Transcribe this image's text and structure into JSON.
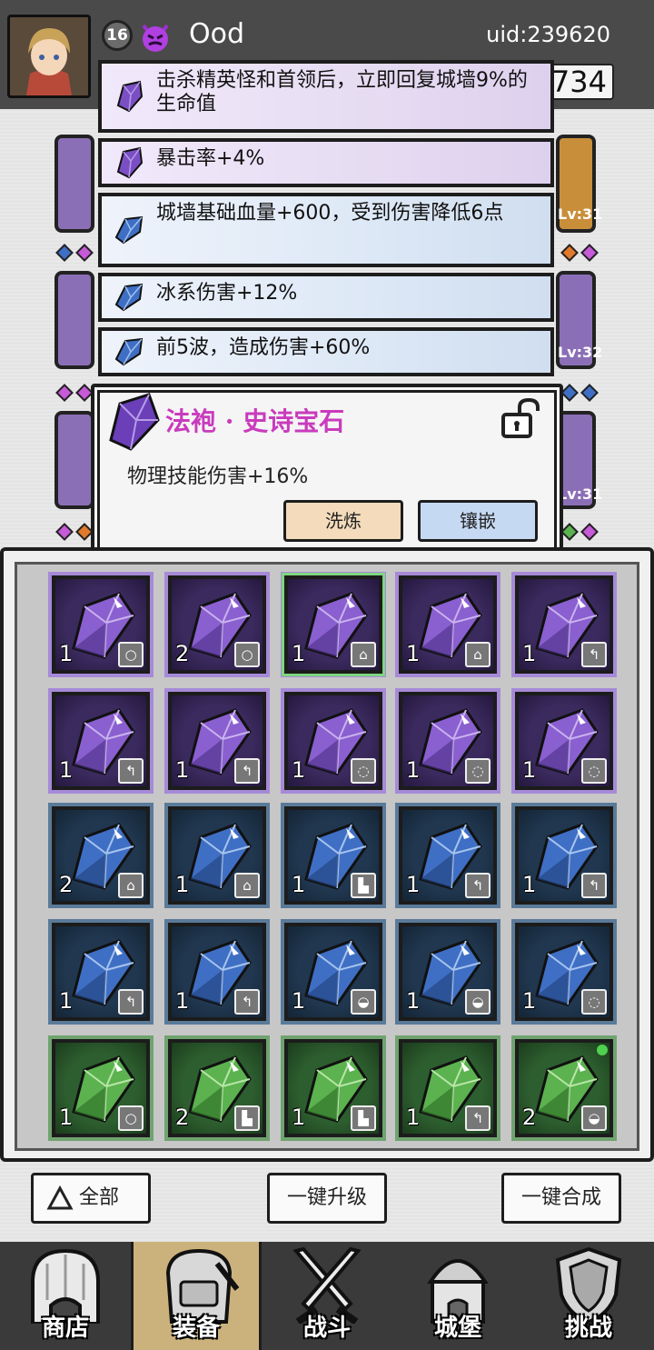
{
  "player": {
    "level": "16",
    "name": "Ood",
    "uid": "uid:239620",
    "gold": "734",
    "status_icon": "devil-icon"
  },
  "equipment_slots": {
    "right_levels": [
      "Lv:31",
      "Lv:32",
      "Lv:31"
    ]
  },
  "stats": [
    {
      "text": "击杀精英怪和首领后，立即回复城墙9%的生命值",
      "gem": "purple"
    },
    {
      "text": "暴击率+4%",
      "gem": "purple"
    },
    {
      "text": "城墙基础血量+600，受到伤害降低6点",
      "gem": "blue"
    },
    {
      "text": "冰系伤害+12%",
      "gem": "blue"
    },
    {
      "text": "前5波，造成伤害+60%",
      "gem": "blue"
    }
  ],
  "popup": {
    "title": "法袍 · 史诗宝石",
    "description": "物理技能伤害+16%",
    "refine_label": "洗炼",
    "inlay_label": "镶嵌",
    "lock_icon": "unlock-icon"
  },
  "inventory": {
    "rows": [
      [
        {
          "rarity": "epic",
          "count": "1",
          "type": "ring"
        },
        {
          "rarity": "epic",
          "count": "2",
          "type": "ring"
        },
        {
          "rarity": "epic",
          "count": "1",
          "type": "robe"
        },
        {
          "rarity": "epic",
          "count": "1",
          "type": "robe"
        },
        {
          "rarity": "epic",
          "count": "1",
          "type": "staff"
        }
      ],
      [
        {
          "rarity": "epic",
          "count": "1",
          "type": "staff"
        },
        {
          "rarity": "epic",
          "count": "1",
          "type": "staff"
        },
        {
          "rarity": "epic",
          "count": "1",
          "type": "necklace"
        },
        {
          "rarity": "epic",
          "count": "1",
          "type": "necklace"
        },
        {
          "rarity": "epic",
          "count": "1",
          "type": "necklace"
        }
      ],
      [
        {
          "rarity": "rare",
          "count": "2",
          "type": "robe"
        },
        {
          "rarity": "rare",
          "count": "1",
          "type": "robe"
        },
        {
          "rarity": "rare",
          "count": "1",
          "type": "boots"
        },
        {
          "rarity": "rare",
          "count": "1",
          "type": "staff"
        },
        {
          "rarity": "rare",
          "count": "1",
          "type": "staff"
        }
      ],
      [
        {
          "rarity": "rare",
          "count": "1",
          "type": "staff"
        },
        {
          "rarity": "rare",
          "count": "1",
          "type": "staff"
        },
        {
          "rarity": "rare",
          "count": "1",
          "type": "hat"
        },
        {
          "rarity": "rare",
          "count": "1",
          "type": "hat"
        },
        {
          "rarity": "rare",
          "count": "1",
          "type": "necklace"
        }
      ],
      [
        {
          "rarity": "uncommon",
          "count": "1",
          "type": "ring"
        },
        {
          "rarity": "uncommon",
          "count": "2",
          "type": "boots"
        },
        {
          "rarity": "uncommon",
          "count": "1",
          "type": "boots"
        },
        {
          "rarity": "uncommon",
          "count": "1",
          "type": "staff"
        },
        {
          "rarity": "uncommon",
          "count": "2",
          "type": "hat"
        }
      ]
    ]
  },
  "actions": {
    "filter_label": "全部",
    "upgrade_all_label": "一键升级",
    "merge_all_label": "一键合成"
  },
  "nav": [
    {
      "label": "商店",
      "icon": "shop-icon"
    },
    {
      "label": "装备",
      "icon": "backpack-icon"
    },
    {
      "label": "战斗",
      "icon": "crossed-swords-icon"
    },
    {
      "label": "城堡",
      "icon": "castle-icon"
    },
    {
      "label": "挑战",
      "icon": "shield-icon"
    }
  ],
  "colors": {
    "epic": "#8a5fd0",
    "rare": "#3f6fc4",
    "uncommon": "#5bb24f",
    "popup_title": "#c93bbd"
  }
}
